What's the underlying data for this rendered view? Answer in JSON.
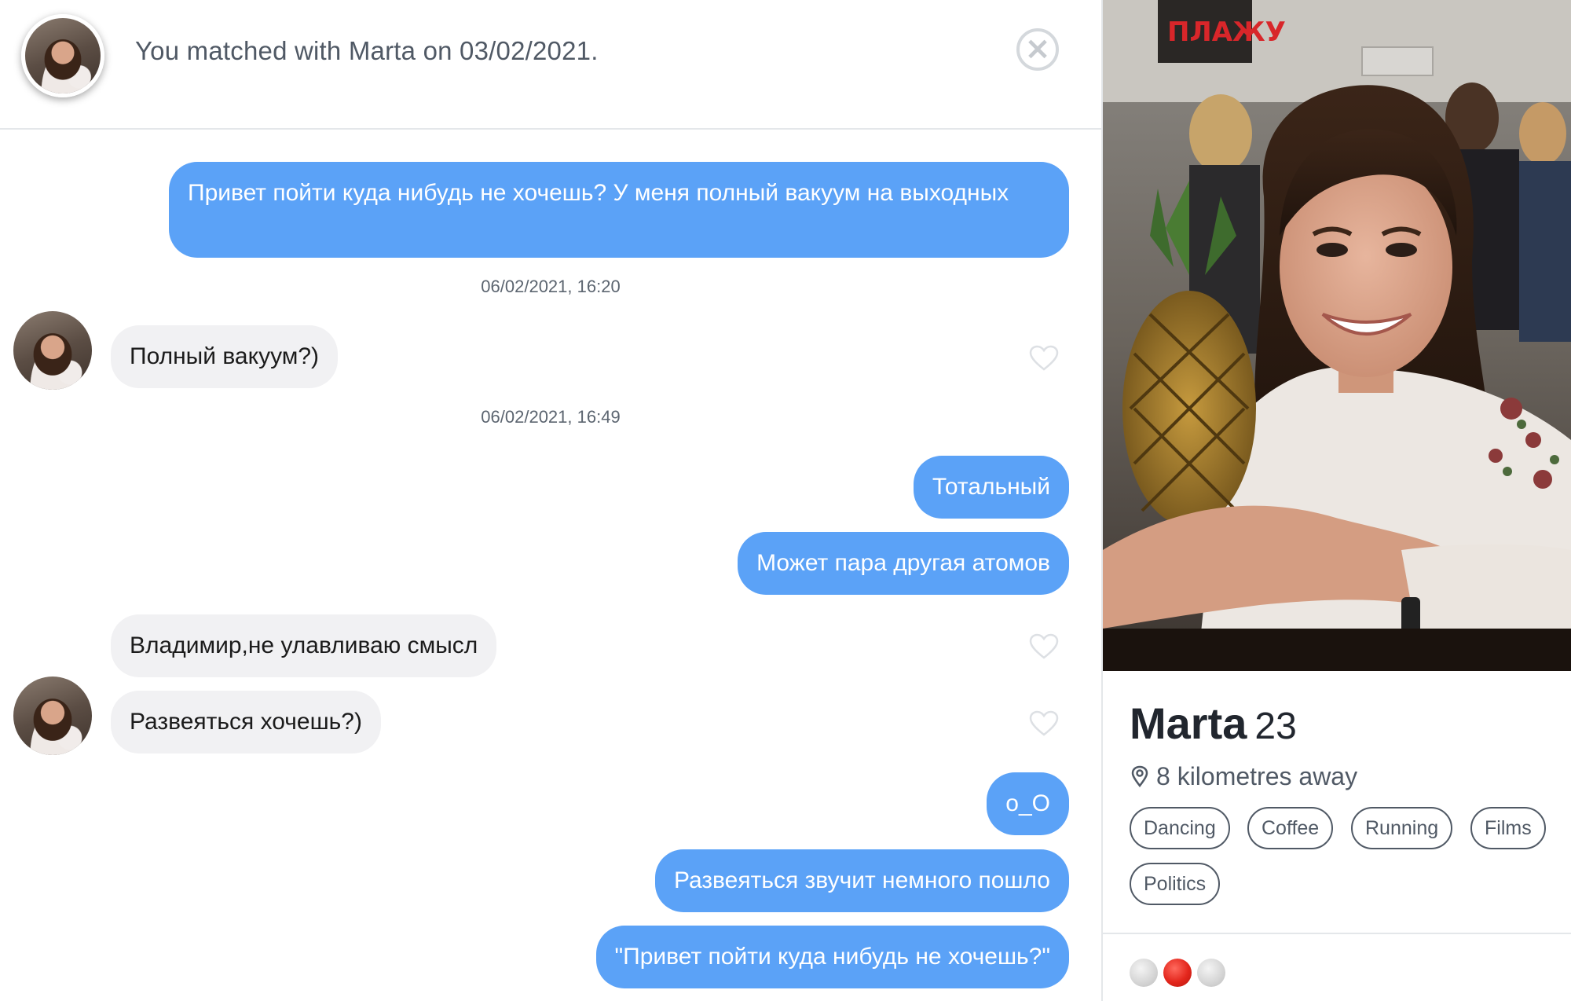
{
  "header": {
    "match_text": "You matched with Marta on 03/02/2021.",
    "close_icon": "close-icon"
  },
  "messages": [
    {
      "direction": "out",
      "text": "Привет пойти куда нибудь не хочешь? У меня полный вакуум на выходных"
    },
    {
      "direction": "timestamp",
      "text": "06/02/2021, 16:20"
    },
    {
      "direction": "in",
      "text": "Полный вакуум?)"
    },
    {
      "direction": "timestamp",
      "text": "06/02/2021, 16:49"
    },
    {
      "direction": "out",
      "text": "Тотальный"
    },
    {
      "direction": "out",
      "text": "Может пара другая атомов"
    },
    {
      "direction": "in",
      "text": "Владимир,не улавливаю смысл"
    },
    {
      "direction": "in",
      "text": "Развеяться хочешь?)"
    },
    {
      "direction": "out",
      "text": "o_O"
    },
    {
      "direction": "out",
      "text": "Развеяться звучит немного пошло"
    },
    {
      "direction": "out",
      "text": "\"Привет пойти куда нибудь не хочешь?\""
    }
  ],
  "profile": {
    "photo_sign": "ПЛАЖУ",
    "name": "Marta",
    "age": "23",
    "distance": "8 kilometres away",
    "interests": [
      "Dancing",
      "Coffee",
      "Running",
      "Films",
      "Politics"
    ],
    "photo_pager": {
      "count": 3,
      "active_index": 1
    }
  },
  "colors": {
    "outgoing_bubble": "#5ba2f7",
    "incoming_bubble": "#f1f1f3",
    "active_dot": "#e3261c"
  }
}
